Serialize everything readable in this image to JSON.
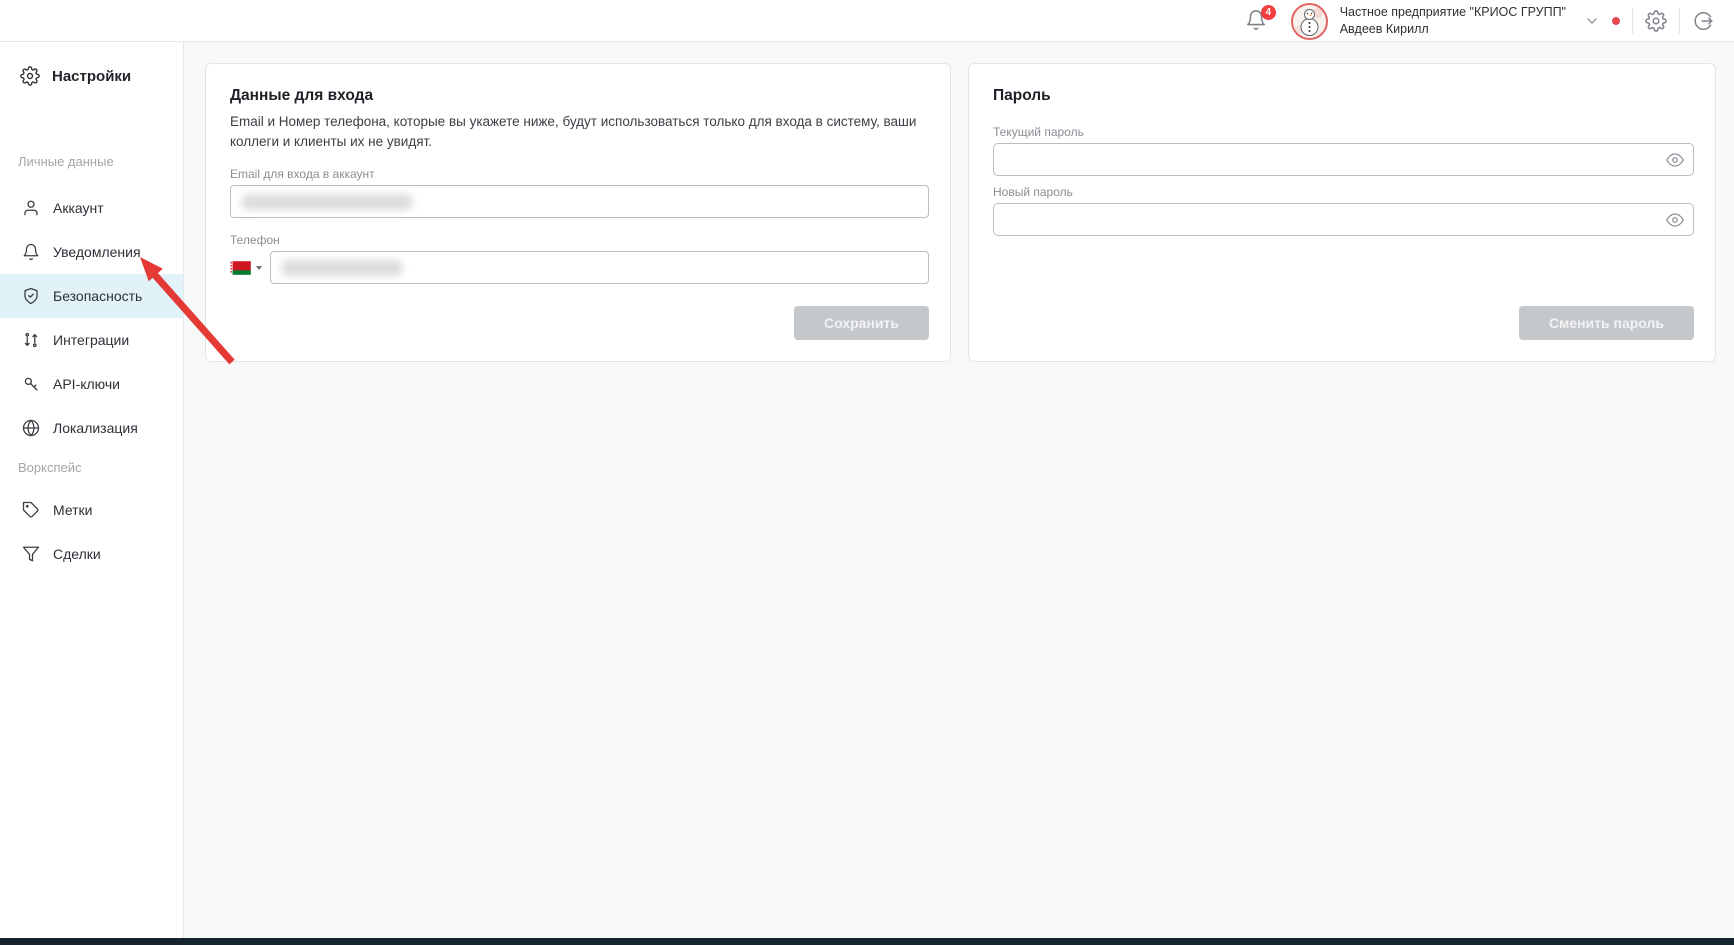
{
  "header": {
    "notifications_count": "4",
    "company_name": "Частное предприятие \"КРИОС ГРУПП\"",
    "user_name": "Авдеев Кирилл"
  },
  "sidebar": {
    "title": "Настройки",
    "sections": [
      {
        "label": "Личные данные"
      },
      {
        "label": "Воркспейс"
      }
    ],
    "items": [
      {
        "label": "Аккаунт",
        "active": false
      },
      {
        "label": "Уведомления",
        "active": false
      },
      {
        "label": "Безопасность",
        "active": true
      },
      {
        "label": "Интеграции",
        "active": false
      },
      {
        "label": "API-ключи",
        "active": false
      },
      {
        "label": "Локализация",
        "active": false
      },
      {
        "label": "Метки",
        "active": false
      },
      {
        "label": "Сделки",
        "active": false
      }
    ]
  },
  "login_card": {
    "title": "Данные для входа",
    "description": "Email и Номер телефона, которые вы укажете ниже, будут использоваться только для входа в систему, ваши коллеги и клиенты их не увидят.",
    "email_label": "Email для входа в аккаунт",
    "phone_label": "Телефон",
    "save_button": "Сохранить"
  },
  "password_card": {
    "title": "Пароль",
    "current_password_label": "Текущий пароль",
    "current_password_value": "",
    "new_password_label": "Новый пароль",
    "new_password_value": "",
    "submit_button": "Сменить пароль"
  },
  "colors": {
    "active_item_bg": "#e1f3f9",
    "annotation_arrow": "#e53935",
    "notification_badge": "#f23e3e",
    "disabled_button_bg": "#c5c8cb",
    "bottom_bar": "#16242f",
    "main_bg": "#f7f8f8"
  }
}
